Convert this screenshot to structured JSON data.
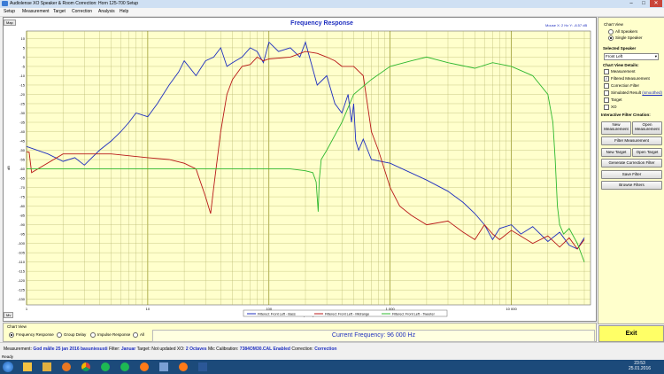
{
  "window": {
    "title": "Audiolense XO Speaker & Room Correction: Horn 125-700 Setup",
    "controls": {
      "minimize": "–",
      "maximize": "□",
      "close": "✕"
    }
  },
  "menu": [
    "Setup",
    "Measurement",
    "Target",
    "Correction",
    "Analysis",
    "Help"
  ],
  "chart_buttons": {
    "map": "Map",
    "mv": "Mv"
  },
  "mouse_readout": {
    "x_label": "Mouse X:",
    "x_value": "2 Hz",
    "y_label": "Y:",
    "y_value": "-8.57 dB"
  },
  "chart_data": {
    "type": "line",
    "title": "Frequency Response",
    "xlabel": "Frequency Hz",
    "ylabel": "dB",
    "x_scale": "log",
    "xlim": [
      1,
      45000
    ],
    "ylim": [
      -133,
      14
    ],
    "grid": true,
    "x_tick_labels": [
      {
        "v": 1,
        "t": "1"
      },
      {
        "v": 10,
        "t": "10"
      },
      {
        "v": 100,
        "t": "100"
      },
      {
        "v": 1000,
        "t": "1 000"
      },
      {
        "v": 10000,
        "t": "10 000"
      }
    ],
    "y_ticks": [
      10,
      5,
      0,
      -5,
      -10,
      -15,
      -20,
      -25,
      -30,
      -35,
      -40,
      -45,
      -50,
      -55,
      -60,
      -65,
      -70,
      -75,
      -80,
      -85,
      -90,
      -95,
      -100,
      -105,
      -110,
      -115,
      -120,
      -125,
      -130
    ],
    "legend": {
      "placement": "bottom-center",
      "entries": [
        "Filtered: Front Left - Bass",
        "Filtered: Front Left - Midrange",
        "Filtered: Front Left - Tweeter"
      ]
    },
    "series": [
      {
        "name": "Filtered: Front Left - Bass",
        "color": "#1f2fbf",
        "x": [
          1,
          1.5,
          2,
          2.5,
          3,
          4,
          5,
          6,
          7,
          8,
          10,
          12,
          15,
          18,
          20,
          25,
          30,
          35,
          40,
          45,
          50,
          60,
          70,
          80,
          90,
          100,
          120,
          150,
          180,
          200,
          250,
          300,
          350,
          400,
          450,
          480,
          500,
          520,
          550,
          600,
          700,
          1000,
          2000,
          3000,
          4000,
          5000,
          6000,
          7000,
          8000,
          10000,
          12000,
          15000,
          20000,
          25000,
          30000,
          35000,
          40000
        ],
        "y": [
          -48,
          -52,
          -56,
          -54,
          -58,
          -50,
          -45,
          -40,
          -35,
          -30,
          -32,
          -25,
          -15,
          -8,
          -2,
          -10,
          -2,
          0,
          5,
          -5,
          -3,
          0,
          5,
          3,
          -3,
          8,
          3,
          5,
          0,
          8,
          -15,
          -10,
          -25,
          -30,
          -20,
          -35,
          -25,
          -45,
          -50,
          -44,
          -55,
          -57,
          -66,
          -72,
          -78,
          -84,
          -90,
          -98,
          -92,
          -90,
          -95,
          -91,
          -99,
          -94,
          -101,
          -103,
          -97
        ]
      },
      {
        "name": "Filtered: Front Left - Midrange",
        "color": "#b81818",
        "x": [
          1,
          1.05,
          1.1,
          2,
          5,
          10,
          15,
          20,
          25,
          30,
          33,
          35,
          40,
          45,
          50,
          60,
          70,
          80,
          90,
          100,
          150,
          200,
          250,
          300,
          350,
          400,
          500,
          600,
          700,
          800,
          1000,
          1200,
          1500,
          2000,
          3000,
          4000,
          5000,
          6000,
          7000,
          8000,
          10000,
          15000,
          20000,
          25000,
          30000,
          35000,
          40000
        ],
        "y": [
          -51,
          -51,
          -62,
          -52,
          -52,
          -54,
          -55,
          -57,
          -60,
          -75,
          -84,
          -70,
          -40,
          -20,
          -12,
          -5,
          -4,
          0,
          -2,
          -1,
          0,
          3,
          2,
          0,
          -2,
          -5,
          -5,
          -10,
          -40,
          -50,
          -70,
          -80,
          -85,
          -90,
          -88,
          -94,
          -98,
          -90,
          -95,
          -98,
          -93,
          -100,
          -96,
          -102,
          -97,
          -103,
          -98
        ]
      },
      {
        "name": "Filtered: Front Left - Tweeter",
        "color": "#2fb82f",
        "x": [
          1,
          10,
          100,
          150,
          200,
          230,
          245,
          255,
          260,
          270,
          300,
          400,
          500,
          700,
          1000,
          1500,
          2000,
          3000,
          5000,
          7000,
          10000,
          15000,
          20000,
          22000,
          23000,
          24000,
          25000,
          27000,
          30000,
          35000,
          40000
        ],
        "y": [
          -60,
          -60,
          -60,
          -60,
          -61,
          -62,
          -67,
          -83,
          -66,
          -55,
          -50,
          -35,
          -20,
          -12,
          -5,
          -2,
          0,
          -3,
          -6,
          -3,
          -5,
          -10,
          -20,
          -35,
          -55,
          -80,
          -90,
          -95,
          -92,
          -100,
          -110
        ]
      }
    ]
  },
  "side": {
    "chart_view_title": "Chart View",
    "chart_view_options": [
      "All Speakers",
      "Single Speaker"
    ],
    "selected_speaker_title": "Selected Speaker",
    "selected_speaker_value": "Front Left",
    "details_title": "Chart View Details:",
    "details": [
      {
        "label": "Measurement",
        "checked": false
      },
      {
        "label": "Filtered Measurement",
        "checked": true
      },
      {
        "label": "Correction Filter",
        "checked": false
      },
      {
        "label": "Simulated Result",
        "checked": false,
        "link": "(smoothed)"
      },
      {
        "label": "Target",
        "checked": false
      },
      {
        "label": "XO",
        "checked": false
      }
    ],
    "interactive_title": "Interactive Filter Creation:",
    "buttons": {
      "new_measurement": "New Measurement",
      "open_measurement": "Open Measurement",
      "filter_measurement": "Filter Measurement",
      "new_target": "New Target",
      "open_target": "Open Target",
      "generate_correction": "Generate Correction Filter",
      "save_filter": "Save Filter",
      "browse_filters": "Browse Filters"
    }
  },
  "bottom": {
    "chart_view_title": "Chart View",
    "options": [
      "Frequency Response",
      "Group Delay",
      "Impulse Response",
      "All"
    ],
    "current_frequency": "Current Frequency: 96 000 Hz",
    "exit": "Exit"
  },
  "status": {
    "measurement_label": "Measurement:",
    "measurement_value": "God målle 25 jan 2016 basuniesusti",
    "filter_label": "Filter:",
    "filter_value": "Januar",
    "target_label": "Target:",
    "target_value": "Not updated",
    "xo_label": "XO:",
    "xo_value": "2 Octaves",
    "mic_label": "Mic Calibration:",
    "mic_value": "7384OM30.CAL Enabled",
    "correction_label": "Correction:",
    "correction_value": "Correction",
    "ready": "Ready"
  },
  "taskbar": {
    "time": "23:53",
    "date": "25.01.2016",
    "apps": [
      "start",
      "explorer",
      "folder",
      "media",
      "chrome",
      "spotify",
      "spotify2",
      "firefox",
      "app",
      "firefox2",
      "word"
    ]
  }
}
